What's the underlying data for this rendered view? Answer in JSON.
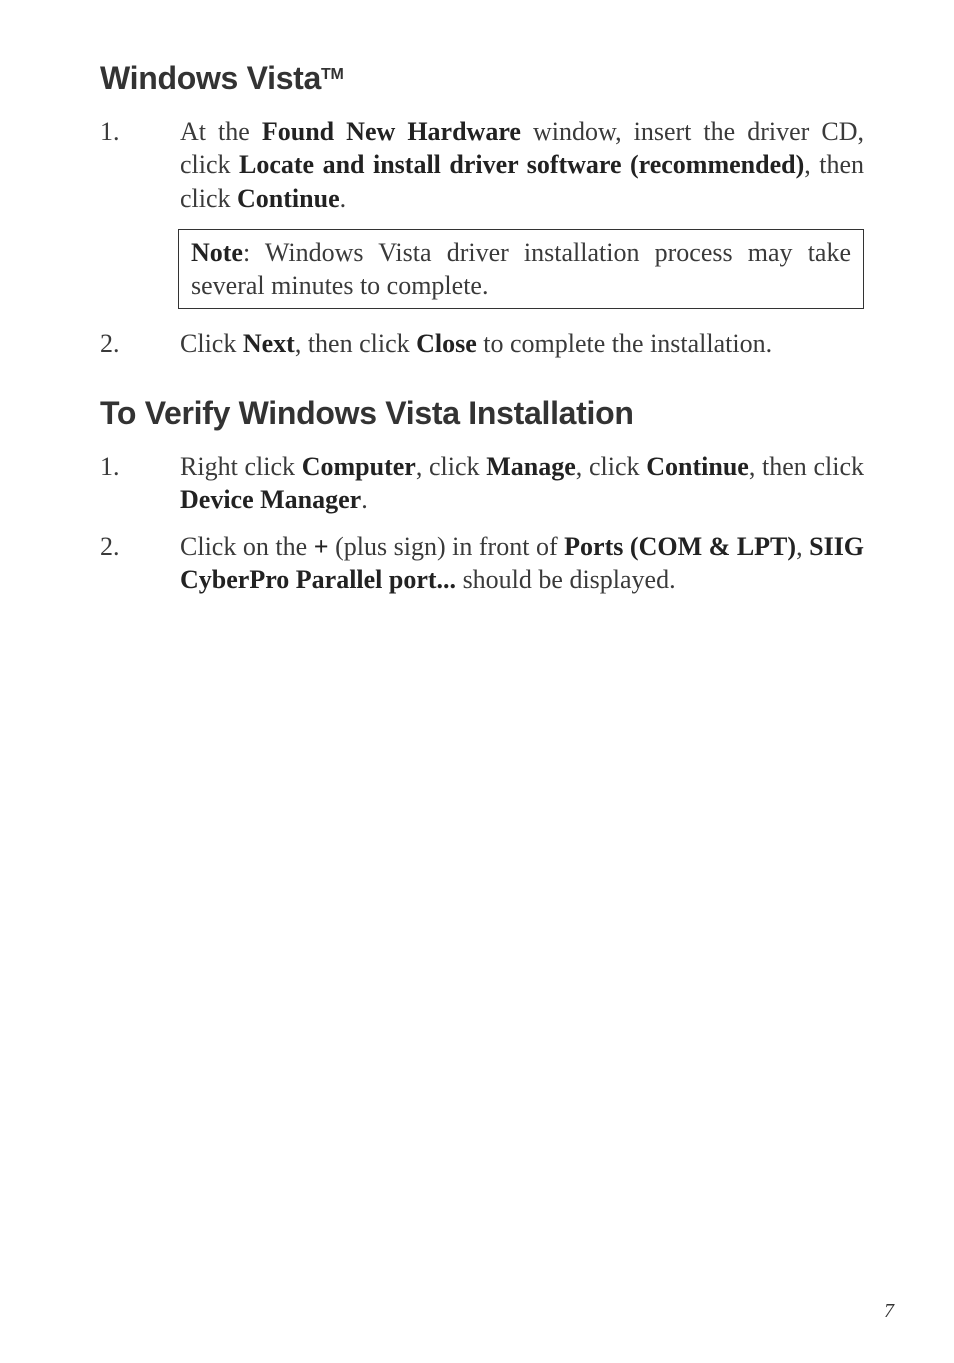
{
  "s1": {
    "heading_pre": "Windows Vista",
    "heading_tm": "TM",
    "step1": {
      "num": "1.",
      "pre": "At the ",
      "b1": "Found New Hardware",
      "mid1": " window, insert the driver CD, click ",
      "b2": "Locate and install driver software (recommended)",
      "mid2": ", then click ",
      "b3": "Continue",
      "post": "."
    },
    "note": {
      "b": "Note",
      "txt": ": Windows Vista driver installation process may take several minutes to complete."
    },
    "step2": {
      "num": "2.",
      "pre": "Click ",
      "b1": "Next",
      "mid1": ", then click ",
      "b2": "Close",
      "post": " to complete the installation."
    }
  },
  "s2": {
    "heading": "To Verify Windows Vista Installation",
    "step1": {
      "num": "1.",
      "pre": "Right click ",
      "b1": "Computer",
      "mid1": ", click ",
      "b2": "Manage",
      "mid2": ", click ",
      "b3": "Continue",
      "mid3": ", then click ",
      "b4": "Device Manager",
      "post": "."
    },
    "step2": {
      "num": "2.",
      "pre": "Click on the ",
      "b1": "+",
      "mid1": " (plus sign) in front of ",
      "b2": "Ports (COM & LPT)",
      "mid2": ", ",
      "b3": "SIIG CyberPro Parallel port...",
      "post": " should be displayed."
    }
  },
  "pagenum": "7"
}
